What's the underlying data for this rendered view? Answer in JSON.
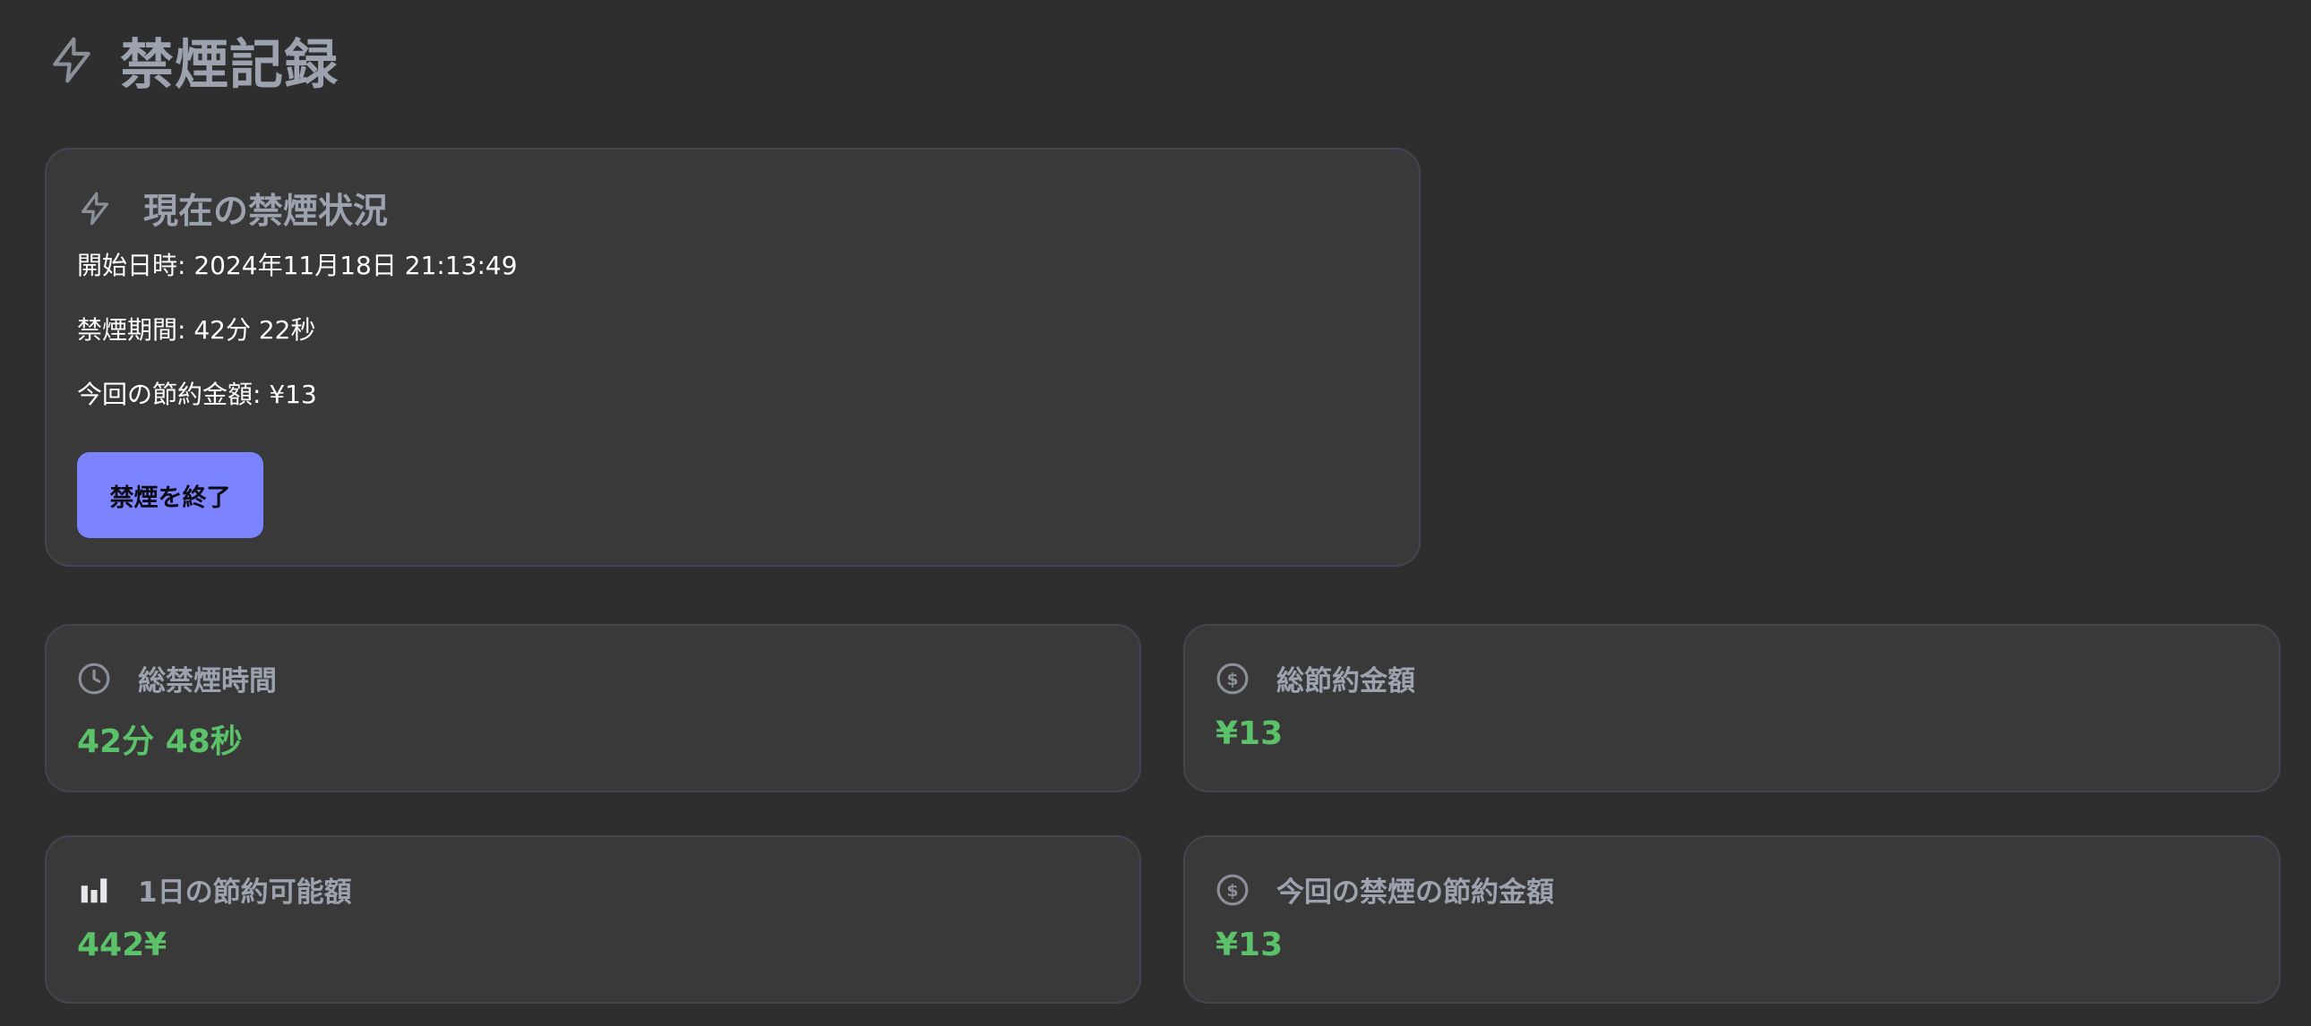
{
  "header": {
    "title": "禁煙記録",
    "icon": "lightning-icon"
  },
  "status": {
    "title": "現在の禁煙状況",
    "icon": "lightning-icon",
    "start": "開始日時: 2024年11月18日 21:13:49",
    "duration": "禁煙期間: 42分 22秒",
    "savings": "今回の節約金額: ¥13",
    "end_button": "禁煙を終了"
  },
  "stats": [
    {
      "label": "総禁煙時間",
      "value": "42分 48秒",
      "icon": "clock-icon"
    },
    {
      "label": "総節約金額",
      "value": "¥13",
      "icon": "dollar-circle-icon"
    },
    {
      "label": "1日の節約可能額",
      "value": "442¥",
      "icon": "bar-chart-icon"
    },
    {
      "label": "今回の禁煙の節約金額",
      "value": "¥13",
      "icon": "dollar-circle-icon"
    }
  ],
  "colors": {
    "background": "#2e2e2e",
    "card": "#393939",
    "card_border": "#454550",
    "muted_text": "#9ca3af",
    "accent_button": "#7c83ff",
    "value_green": "#5cc26a"
  }
}
